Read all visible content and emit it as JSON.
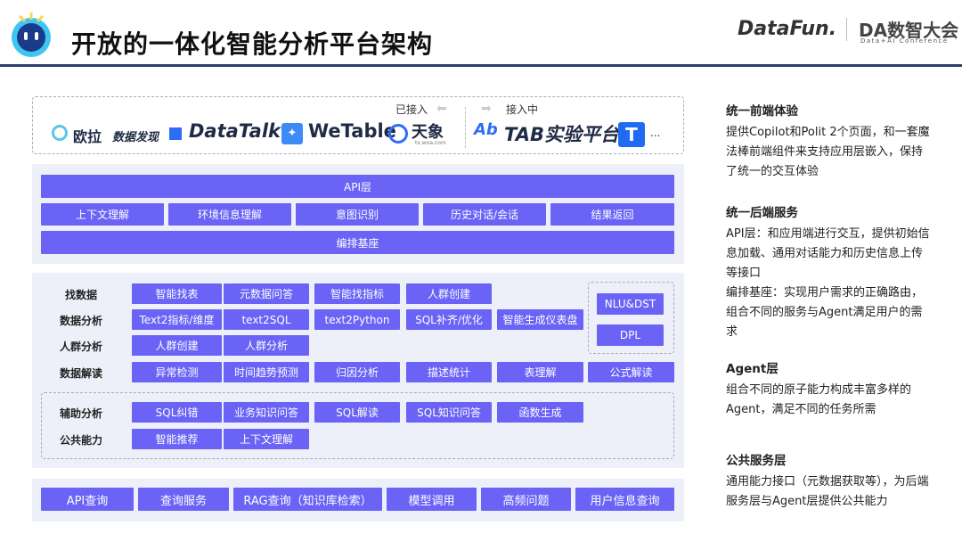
{
  "header": {
    "title": "开放的一体化智能分析平台架构",
    "brand1": "DataFun.",
    "brand2": "DA数智大会",
    "brand2_sub": "Data+AI Conference"
  },
  "partners": {
    "connected_label": "已接入",
    "connecting_label": "接入中",
    "logos": [
      "欧拉",
      "数据发现",
      "DataTalk",
      "WeTable",
      "天象",
      "tx.woa.com",
      "TAB实验平台",
      "..."
    ]
  },
  "frontend_layer": {
    "api": "API层",
    "items": [
      "上下文理解",
      "环境信息理解",
      "意图识别",
      "历史对话/会话",
      "结果返回"
    ],
    "base": "编排基座"
  },
  "agent_layer": {
    "rows": [
      {
        "label": "找数据",
        "items": [
          "智能找表",
          "元数据问答",
          "智能找指标",
          "人群创建"
        ]
      },
      {
        "label": "数据分析",
        "items": [
          "Text2指标/维度",
          "text2SQL",
          "text2Python",
          "SQL补齐/优化",
          "智能生成仪表盘"
        ]
      },
      {
        "label": "人群分析",
        "items": [
          "人群创建",
          "人群分析"
        ]
      },
      {
        "label": "数据解读",
        "items": [
          "异常检测",
          "时间趋势预测",
          "归因分析",
          "描述统计",
          "表理解",
          "公式解读"
        ]
      }
    ],
    "side": [
      "NLU&DST",
      "DPL"
    ],
    "common_rows": [
      {
        "label": "辅助分析",
        "items": [
          "SQL纠错",
          "业务知识问答",
          "SQL解读",
          "SQL知识问答",
          "函数生成"
        ]
      },
      {
        "label": "公共能力",
        "items": [
          "智能推荐",
          "上下文理解"
        ]
      }
    ]
  },
  "service_layer": {
    "items": [
      "API查询",
      "查询服务",
      "RAG查询（知识库检索）",
      "模型调用",
      "高频问题",
      "用户信息查询"
    ]
  },
  "notes": [
    {
      "heading": "统一前端体验",
      "lines": [
        "提供Copilot和Polit 2个页面，和一套魔法棒前端组件来支持应用层嵌入，保持了统一的交互体验"
      ]
    },
    {
      "heading": "统一后端服务",
      "lines": [
        "API层：和应用端进行交互，提供初始信息加载、通用对话能力和历史信息上传等接口",
        "编排基座：实现用户需求的正确路由，组合不同的服务与Agent满足用户的需求"
      ]
    },
    {
      "heading": "Agent层",
      "lines": [
        "组合不同的原子能力构成丰富多样的Agent，满足不同的任务所需"
      ]
    },
    {
      "heading": "公共服务层",
      "lines": [
        "通用能力接口（元数据获取等），为后端服务层与Agent层提供公共能力"
      ]
    }
  ],
  "colors": {
    "box": "#6a63f6",
    "panel": "#eef0f9",
    "rule": "#2c3e6b"
  }
}
